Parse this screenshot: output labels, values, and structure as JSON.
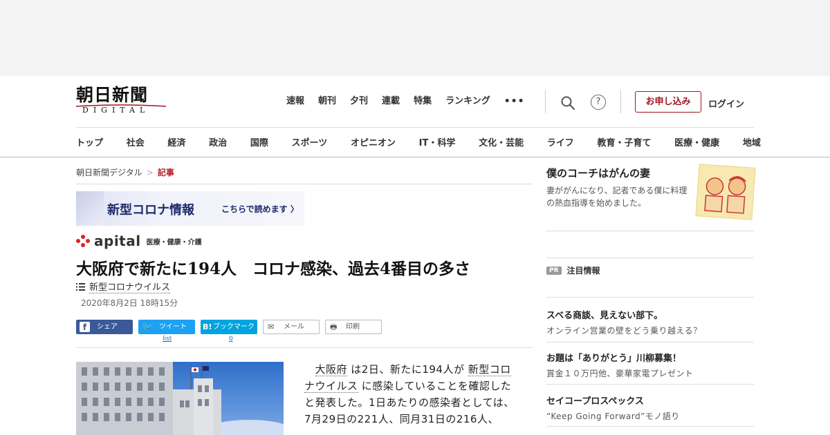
{
  "header": {
    "logo_main": "朝日新聞",
    "logo_sub": "DIGITAL",
    "top_nav": [
      "速報",
      "朝刊",
      "夕刊",
      "連載",
      "特集",
      "ランキング",
      "•••"
    ],
    "help_glyph": "?",
    "subscribe_label": "お申し込み",
    "login_label": "ログイン",
    "brand_color": "#a0141e"
  },
  "category_nav": [
    "トップ",
    "社会",
    "経済",
    "政治",
    "国際",
    "スポーツ",
    "オピニオン",
    "IT・科学",
    "文化・芸能",
    "ライフ",
    "教育・子育て",
    "医療・健康",
    "地域"
  ],
  "breadcrumb": {
    "home": "朝日新聞デジタル",
    "separator": ">",
    "current": "記事"
  },
  "corona_banner": {
    "title": "新型コロナ情報",
    "cta": "こちらで読めます 〉"
  },
  "apital": {
    "wordmark": "apital",
    "section": "医療・健康・介護"
  },
  "article": {
    "headline": "大阪府で新たに194人　コロナ感染、過去4番目の多さ",
    "tag": "新型コロナウイルス",
    "date": "2020年8月2日 18時15分",
    "body_p1_a": "大阪府",
    "body_p1_b": " は2日、新たに194人が ",
    "body_p1_c": "新型コロナウイルス",
    "body_p1_d": " に感染していることを確認したと発表した。1日あたりの感染者としては、7月29日の221人、同月31日の216人、"
  },
  "share": {
    "facebook": "シェア",
    "twitter": "ツイート",
    "twitter_count": "list",
    "hatena": "ブックマーク",
    "hatena_icon": "B!",
    "hatena_count": "0",
    "mail": "メール",
    "print": "印刷"
  },
  "sidebar": {
    "feature_title": "僕のコーチはがんの妻",
    "feature_desc": "妻ががんになり、記者である僕に料理の熱血指導を始めました。",
    "pr_badge": "PR",
    "pr_label": "注目情報",
    "promos": [
      {
        "title": "スベる商談、見えない部下。",
        "desc": "オンライン営業の壁をどう乗り越える？"
      },
      {
        "title": "お題は「ありがとう」川柳募集！",
        "desc": "賞金１０万円他、豪華家電プレゼント"
      },
      {
        "title": "セイコープロスペックス",
        "desc": "“Keep Going Forward”モノ語り"
      }
    ]
  }
}
